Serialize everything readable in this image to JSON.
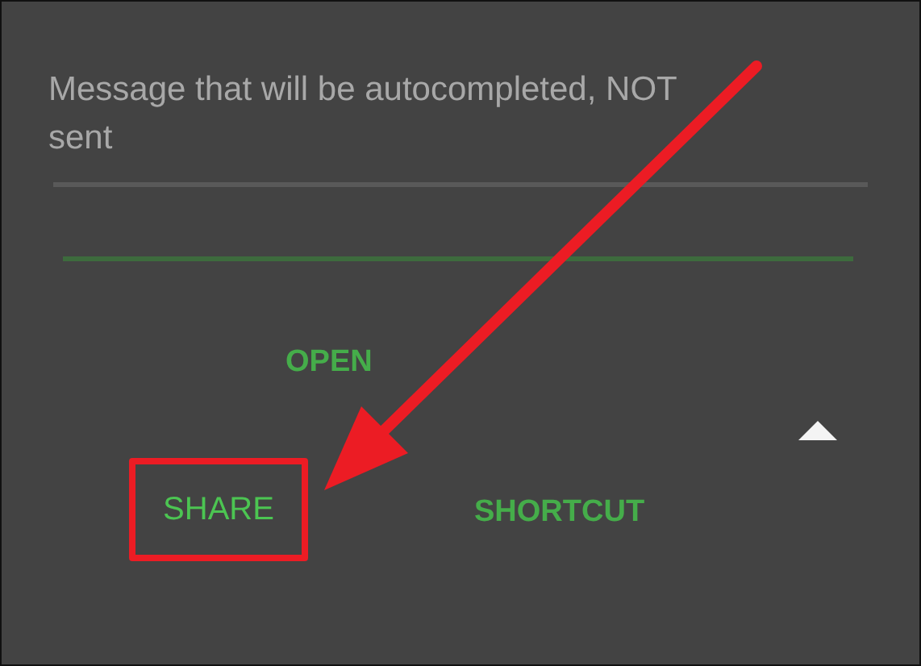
{
  "message_field": {
    "placeholder": "Message that will be autocompleted, NOT sent"
  },
  "input_field": {
    "focused": true
  },
  "buttons": [
    {
      "label": "OPEN",
      "highlighted": false
    },
    {
      "label": "SHARE",
      "highlighted": true
    },
    {
      "label": "SHORTCUT",
      "highlighted": false
    }
  ]
}
